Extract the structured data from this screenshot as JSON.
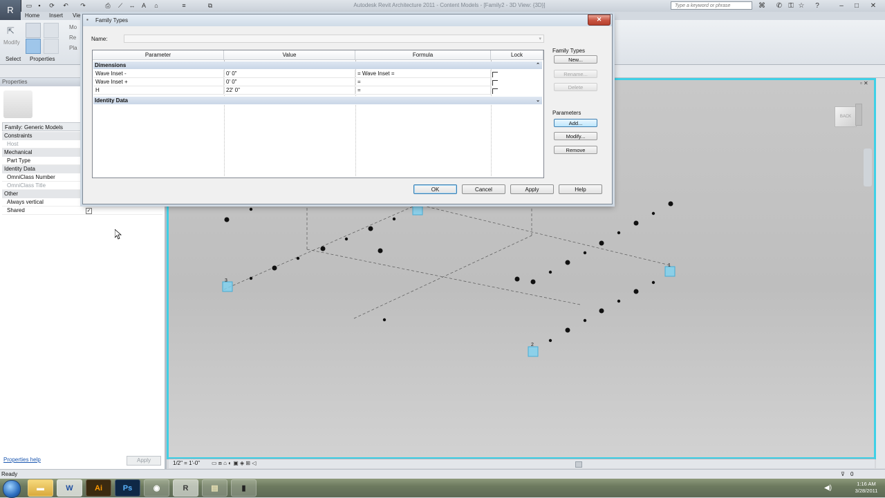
{
  "app": {
    "title": "Autodesk Revit Architecture 2011 - Content Models - [Family2 - 3D View: {3D}]",
    "search_placeholder": "Type a keyword or phrase",
    "app_menu_icon": "R"
  },
  "ribbon": {
    "tabs": [
      "Home",
      "Insert",
      "Vie"
    ],
    "modify_label": "Modify",
    "select_label": "Select",
    "properties_label": "Properties",
    "small_labels": [
      "Mo",
      "Re",
      "Pla"
    ]
  },
  "properties": {
    "title": "Properties",
    "family_selector": "Family: Generic Models",
    "rows": [
      {
        "kind": "group",
        "label": "Constraints"
      },
      {
        "kind": "item",
        "label": "Host",
        "dim": true
      },
      {
        "kind": "group",
        "label": "Mechanical"
      },
      {
        "kind": "item",
        "label": "Part Type",
        "dim": false
      },
      {
        "kind": "group",
        "label": "Identity Data"
      },
      {
        "kind": "item",
        "label": "OmniClass Number",
        "dim": false
      },
      {
        "kind": "item",
        "label": "OmniClass Title",
        "dim": true
      },
      {
        "kind": "group",
        "label": "Other"
      },
      {
        "kind": "item",
        "label": "Always vertical",
        "dim": false
      },
      {
        "kind": "item",
        "label": "Shared",
        "dim": false,
        "checked": true
      }
    ],
    "help_link": "Properties help",
    "apply_label": "Apply"
  },
  "dialog": {
    "title": "Family Types",
    "name_label": "Name:",
    "name_value": "",
    "columns": [
      "Parameter",
      "Value",
      "Formula",
      "Lock"
    ],
    "groups": [
      {
        "label": "Dimensions",
        "rows": [
          {
            "parameter": "Wave Inset -",
            "value": "0'  0\"",
            "formula": "= Wave Inset ="
          },
          {
            "parameter": "Wave Inset +",
            "value": "0'  0\"",
            "formula": "="
          },
          {
            "parameter": "H",
            "value": "22'  0\"",
            "formula": "="
          }
        ]
      },
      {
        "label": "Identity Data",
        "rows": []
      }
    ],
    "family_types_label": "Family Types",
    "new_label": "New...",
    "rename_label": "Rename...",
    "delete_label": "Delete",
    "parameters_label": "Parameters",
    "add_label": "Add...",
    "modify_label": "Modify...",
    "remove_label": "Remove",
    "ok_label": "OK",
    "cancel_label": "Cancel",
    "apply_label": "Apply",
    "help_label": "Help"
  },
  "viewport": {
    "point_labels": [
      "3",
      "1",
      "2"
    ],
    "viewcube_face": "BACK",
    "scale_label": "1/2\" = 1'-0\""
  },
  "status": {
    "text": "Ready",
    "filter_count": "0"
  },
  "taskbar": {
    "apps": [
      "folder-icon",
      "word-icon",
      "Ai",
      "Ps",
      "chrome-icon",
      "revit-icon",
      "explorer-icon",
      "tool-icon"
    ],
    "time": "1:16 AM",
    "date": "3/28/2011"
  }
}
